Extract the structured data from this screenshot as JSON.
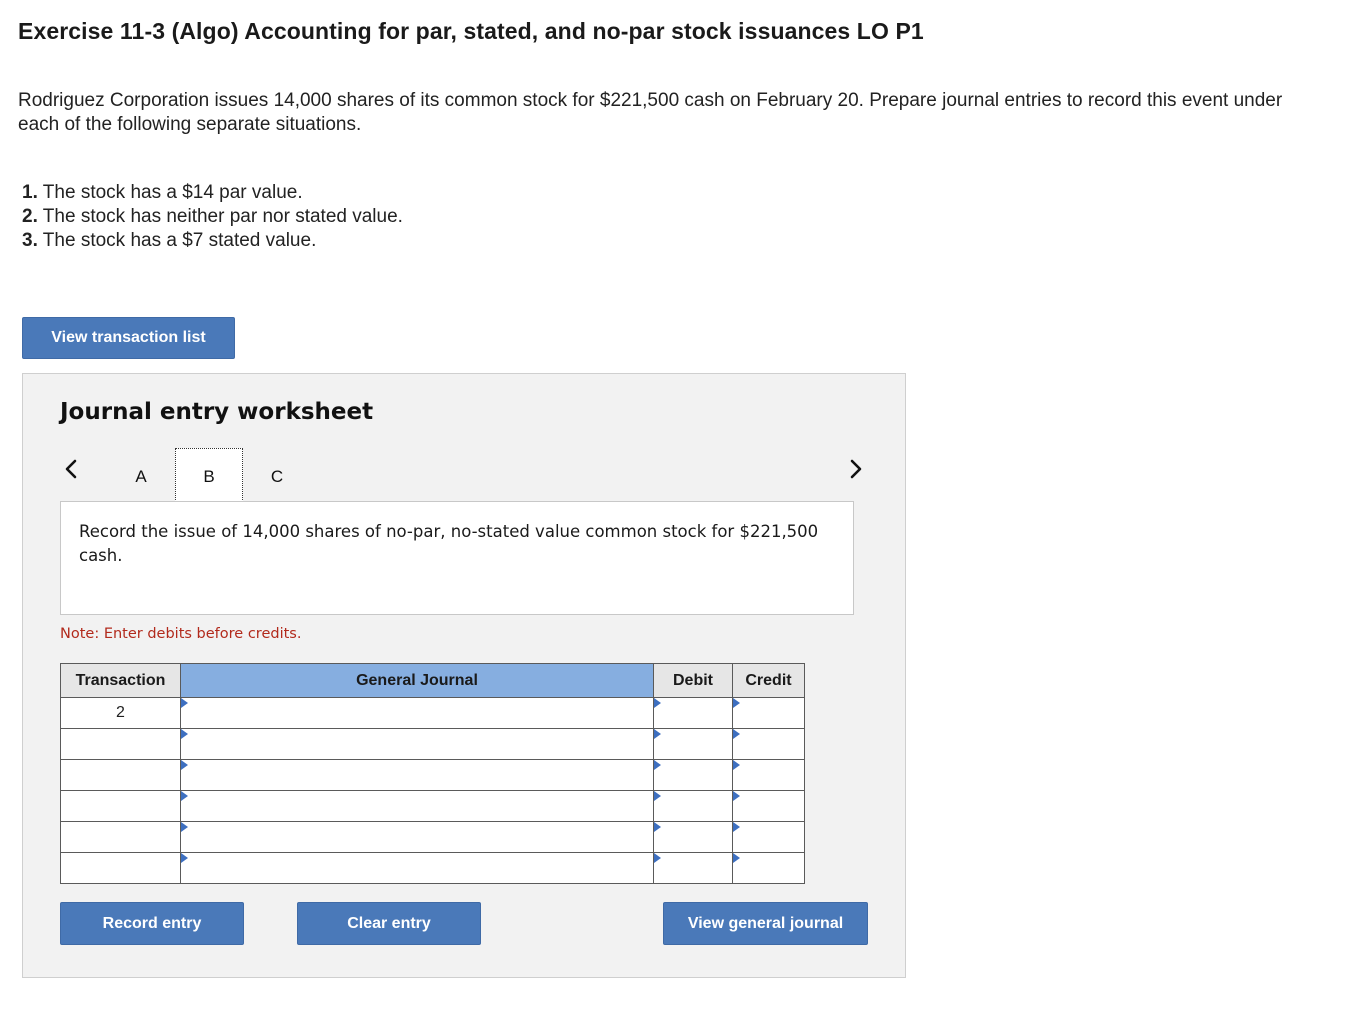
{
  "page": {
    "title": "Exercise 11-3 (Algo) Accounting for par, stated, and no-par stock issuances LO P1",
    "intro": "Rodriguez Corporation issues 14,000 shares of its common stock for $221,500 cash on February 20. Prepare journal entries to record this event under each of the following separate situations.",
    "requirements": [
      {
        "num": "1.",
        "text": " The stock has a $14 par value."
      },
      {
        "num": "2.",
        "text": " The stock has neither par nor stated value."
      },
      {
        "num": "3.",
        "text": " The stock has a $7 stated value."
      }
    ],
    "view_transaction_list_label": "View transaction list"
  },
  "worksheet": {
    "title": "Journal entry worksheet",
    "tabs": [
      "A",
      "B",
      "C"
    ],
    "active_tab": "B",
    "description": "Record the issue of 14,000 shares of no-par, no-stated value common stock for $221,500 cash.",
    "note": "Note: Enter debits before credits.",
    "columns": {
      "transaction": "Transaction",
      "general_journal": "General Journal",
      "debit": "Debit",
      "credit": "Credit"
    },
    "rows": [
      {
        "transaction": "2",
        "account": "",
        "debit": "",
        "credit": ""
      },
      {
        "transaction": "",
        "account": "",
        "debit": "",
        "credit": ""
      },
      {
        "transaction": "",
        "account": "",
        "debit": "",
        "credit": ""
      },
      {
        "transaction": "",
        "account": "",
        "debit": "",
        "credit": ""
      },
      {
        "transaction": "",
        "account": "",
        "debit": "",
        "credit": ""
      },
      {
        "transaction": "",
        "account": "",
        "debit": "",
        "credit": ""
      }
    ],
    "buttons": {
      "record": "Record entry",
      "clear": "Clear entry",
      "view_general_journal": "View general journal"
    }
  },
  "colors": {
    "button_blue": "#4a79b9",
    "header_blue": "#86aee0",
    "note_red": "#b22a1c",
    "marker_blue": "#3d6fc0"
  },
  "icons": {
    "prev": "chevron-left-icon",
    "next": "chevron-right-icon"
  }
}
